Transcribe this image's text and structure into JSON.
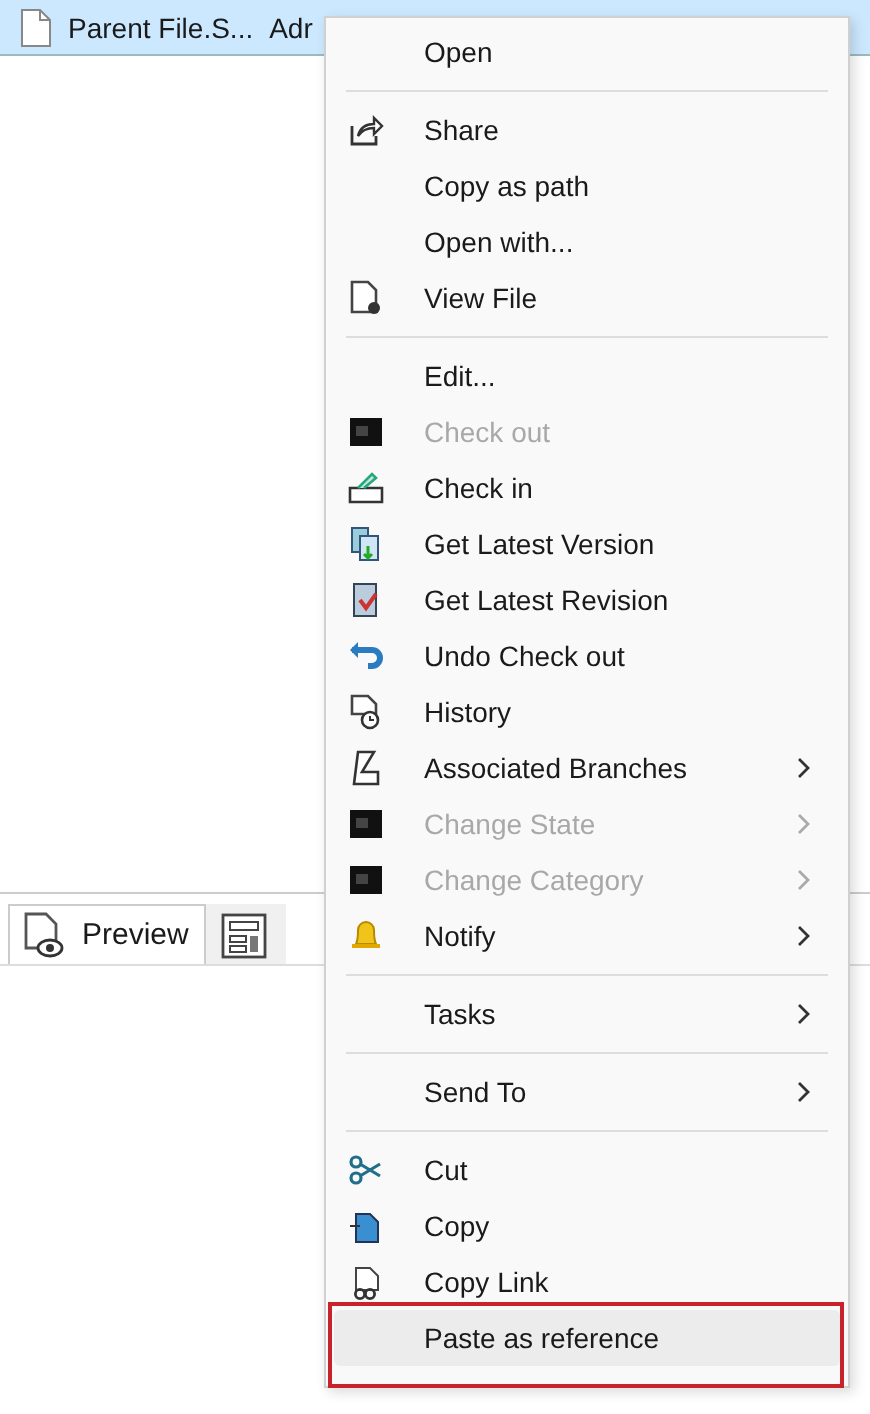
{
  "file_row": {
    "name": "Parent File.S...",
    "column_2": "Adr",
    "selected": true
  },
  "tabs": [
    {
      "label": "Preview",
      "selected": true
    },
    {
      "selected": false
    }
  ],
  "context_menu": {
    "items": [
      {
        "kind": "item",
        "label": "Open",
        "selected": false
      },
      {
        "kind": "separator"
      },
      {
        "kind": "item",
        "label": "Share",
        "selected": false
      },
      {
        "kind": "item",
        "label": "Copy as path",
        "selected": false
      },
      {
        "kind": "item",
        "label": "Open with...",
        "selected": false
      },
      {
        "kind": "item",
        "label": "View File",
        "selected": false
      },
      {
        "kind": "separator"
      },
      {
        "kind": "item",
        "label": "Edit...",
        "selected": false
      },
      {
        "kind": "item",
        "label": "Check out",
        "disabled": true,
        "selected": false
      },
      {
        "kind": "item",
        "label": "Check in",
        "selected": false
      },
      {
        "kind": "item",
        "label": "Get Latest Version",
        "selected": false
      },
      {
        "kind": "item",
        "label": "Get Latest Revision",
        "selected": false
      },
      {
        "kind": "item",
        "label": "Undo Check out",
        "selected": false
      },
      {
        "kind": "item",
        "label": "History",
        "selected": false
      },
      {
        "kind": "item",
        "label": "Associated Branches",
        "submenu": true,
        "selected": false
      },
      {
        "kind": "item",
        "label": "Change State",
        "disabled": true,
        "submenu": true,
        "selected": false
      },
      {
        "kind": "item",
        "label": "Change Category",
        "disabled": true,
        "submenu": true,
        "selected": false
      },
      {
        "kind": "item",
        "label": "Notify",
        "submenu": true,
        "selected": false
      },
      {
        "kind": "separator"
      },
      {
        "kind": "item",
        "label": "Tasks",
        "submenu": true,
        "selected": false
      },
      {
        "kind": "separator"
      },
      {
        "kind": "item",
        "label": "Send To",
        "submenu": true,
        "selected": false
      },
      {
        "kind": "separator"
      },
      {
        "kind": "item",
        "label": "Cut",
        "selected": false
      },
      {
        "kind": "item",
        "label": "Copy",
        "selected": false
      },
      {
        "kind": "item",
        "label": "Copy Link",
        "selected": false
      },
      {
        "kind": "item",
        "label": "Paste as reference",
        "selected": true,
        "outlined": true
      }
    ]
  }
}
